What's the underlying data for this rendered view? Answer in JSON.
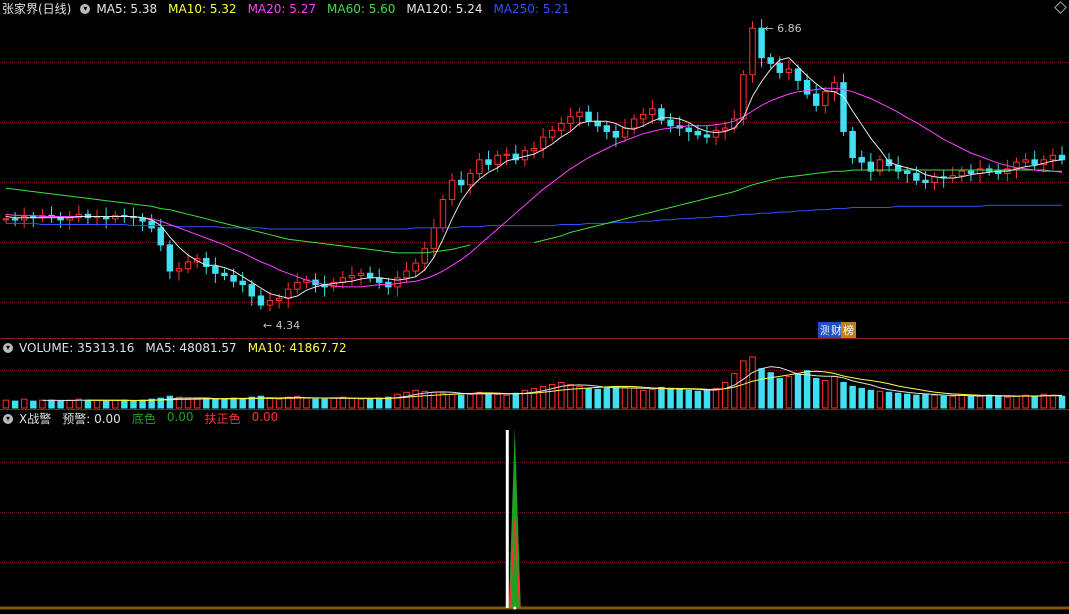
{
  "main_pane": {
    "title": "张家界(日线)",
    "ma_labels": [
      {
        "text": "MA5: 5.38",
        "color": "#e6e6e6"
      },
      {
        "text": "MA10: 5.32",
        "color": "#ffff40"
      },
      {
        "text": "MA20: 5.27",
        "color": "#ff40ff"
      },
      {
        "text": "MA60: 5.60",
        "color": "#40e040"
      },
      {
        "text": "MA120: 5.24",
        "color": "#e6e6e6"
      },
      {
        "text": "MA250: 5.21",
        "color": "#3050ff"
      }
    ],
    "high_label": "6.86",
    "low_label": "4.34",
    "badge_1": "测",
    "badge_2": "财",
    "badge_3": "榜"
  },
  "volume_pane": {
    "labels": [
      {
        "text": "VOLUME: 35313.16",
        "color": "#e0e0e0"
      },
      {
        "text": "MA5: 48081.57",
        "color": "#e0e0e0"
      },
      {
        "text": "MA10: 41867.72",
        "color": "#ffff40"
      }
    ]
  },
  "indicator_pane": {
    "labels": [
      {
        "text": "X战警",
        "color": "#e0e0e0"
      },
      {
        "text": "预警: 0.00",
        "color": "#e0e0e0"
      },
      {
        "text": "底色",
        "color": "#20a020"
      },
      {
        "text": "0.00",
        "color": "#20a020"
      },
      {
        "text": "扶正色",
        "color": "#ff3030"
      },
      {
        "text": "0.00",
        "color": "#ff3030"
      }
    ]
  },
  "chart_data": {
    "type": "candlestick",
    "price_range": [
      4.2,
      6.95
    ],
    "high": 6.86,
    "low": 4.34,
    "up_color": "#ff3030",
    "down_color": "#40e0f0",
    "closes": [
      5.18,
      5.17,
      5.2,
      5.19,
      5.21,
      5.2,
      5.17,
      5.19,
      5.22,
      5.19,
      5.2,
      5.18,
      5.21,
      5.2,
      5.19,
      5.16,
      5.1,
      4.95,
      4.72,
      4.74,
      4.8,
      4.83,
      4.76,
      4.7,
      4.68,
      4.63,
      4.6,
      4.5,
      4.42,
      4.46,
      4.48,
      4.56,
      4.62,
      4.64,
      4.6,
      4.58,
      4.62,
      4.66,
      4.68,
      4.7,
      4.66,
      4.62,
      4.58,
      4.66,
      4.72,
      4.79,
      4.92,
      5.1,
      5.35,
      5.52,
      5.48,
      5.58,
      5.7,
      5.66,
      5.74,
      5.75,
      5.7,
      5.78,
      5.8,
      5.9,
      5.96,
      6.02,
      6.08,
      6.12,
      6.04,
      6.0,
      5.95,
      5.9,
      5.98,
      6.06,
      6.1,
      6.15,
      6.05,
      6.0,
      5.98,
      5.95,
      5.92,
      5.9,
      5.96,
      5.98,
      6.06,
      6.45,
      6.86,
      6.6,
      6.55,
      6.47,
      6.5,
      6.4,
      6.28,
      6.18,
      6.3,
      6.38,
      5.95,
      5.72,
      5.68,
      5.6,
      5.7,
      5.65,
      5.6,
      5.58,
      5.52,
      5.5,
      5.55,
      5.54,
      5.56,
      5.6,
      5.58,
      5.62,
      5.6,
      5.58,
      5.62,
      5.68,
      5.7,
      5.66,
      5.7,
      5.74,
      5.7
    ],
    "volumes": [
      8,
      7,
      9,
      7,
      8,
      8,
      7,
      8,
      9,
      8,
      8,
      7,
      8,
      8,
      7,
      8,
      9,
      10,
      12,
      11,
      9,
      9,
      10,
      9,
      9,
      10,
      9,
      11,
      12,
      10,
      9,
      11,
      12,
      10,
      9,
      9,
      10,
      11,
      10,
      9,
      9,
      10,
      11,
      14,
      16,
      18,
      17,
      16,
      15,
      14,
      13,
      14,
      16,
      15,
      14,
      13,
      15,
      18,
      20,
      22,
      24,
      26,
      24,
      22,
      20,
      19,
      20,
      22,
      21,
      20,
      18,
      19,
      21,
      20,
      19,
      18,
      17,
      18,
      20,
      26,
      35,
      48,
      52,
      40,
      36,
      30,
      32,
      34,
      38,
      30,
      28,
      32,
      26,
      22,
      20,
      18,
      17,
      16,
      15,
      14,
      13,
      14,
      13,
      12,
      12,
      13,
      12,
      12,
      13,
      12,
      11,
      12,
      13,
      12,
      14,
      13,
      12
    ],
    "ma5": [
      5.2,
      5.19,
      5.19,
      5.19,
      5.19,
      5.19,
      5.19,
      5.19,
      5.2,
      5.2,
      5.2,
      5.2,
      5.2,
      5.2,
      5.2,
      5.19,
      5.17,
      5.12,
      5.02,
      4.93,
      4.86,
      4.81,
      4.77,
      4.77,
      4.75,
      4.72,
      4.67,
      4.62,
      4.57,
      4.52,
      4.5,
      4.48,
      4.5,
      4.55,
      4.58,
      4.6,
      4.61,
      4.62,
      4.63,
      4.65,
      4.66,
      4.66,
      4.65,
      4.64,
      4.65,
      4.67,
      4.73,
      4.84,
      5.0,
      5.18,
      5.34,
      5.45,
      5.53,
      5.59,
      5.63,
      5.69,
      5.71,
      5.73,
      5.75,
      5.79,
      5.84,
      5.9,
      5.95,
      6.02,
      6.04,
      6.04,
      6.04,
      6.02,
      5.98,
      5.97,
      6.0,
      6.04,
      6.07,
      6.07,
      6.06,
      6.03,
      5.98,
      5.95,
      5.94,
      5.95,
      5.98,
      6.07,
      6.26,
      6.39,
      6.5,
      6.58,
      6.6,
      6.52,
      6.44,
      6.37,
      6.31,
      6.3,
      6.26,
      6.13,
      6.01,
      5.89,
      5.79,
      5.68,
      5.65,
      5.63,
      5.61,
      5.57,
      5.55,
      5.54,
      5.54,
      5.55,
      5.57,
      5.58,
      5.59,
      5.6,
      5.6,
      5.62,
      5.64,
      5.65,
      5.67,
      5.69,
      5.7
    ],
    "ma20": [
      5.22,
      5.21,
      5.21,
      5.21,
      5.2,
      5.2,
      5.2,
      5.2,
      5.2,
      5.2,
      5.2,
      5.2,
      5.2,
      5.2,
      5.2,
      5.19,
      5.18,
      5.16,
      5.13,
      5.1,
      5.07,
      5.04,
      5.01,
      4.98,
      4.95,
      4.91,
      4.88,
      4.84,
      4.8,
      4.77,
      4.73,
      4.7,
      4.67,
      4.64,
      4.62,
      4.6,
      4.59,
      4.58,
      4.58,
      4.58,
      4.59,
      4.6,
      4.6,
      4.61,
      4.62,
      4.63,
      4.65,
      4.68,
      4.72,
      4.77,
      4.82,
      4.88,
      4.95,
      5.02,
      5.09,
      5.16,
      5.23,
      5.3,
      5.37,
      5.44,
      5.5,
      5.56,
      5.62,
      5.67,
      5.72,
      5.76,
      5.8,
      5.84,
      5.87,
      5.9,
      5.93,
      5.95,
      5.97,
      5.98,
      5.99,
      6.0,
      6.0,
      6.0,
      6.01,
      6.02,
      6.04,
      6.08,
      6.13,
      6.18,
      6.22,
      6.25,
      6.28,
      6.3,
      6.31,
      6.32,
      6.33,
      6.33,
      6.32,
      6.3,
      6.27,
      6.24,
      6.2,
      6.16,
      6.12,
      6.07,
      6.03,
      5.98,
      5.93,
      5.88,
      5.84,
      5.8,
      5.76,
      5.73,
      5.7,
      5.67,
      5.65,
      5.63,
      5.62,
      5.61,
      5.6,
      5.6,
      5.59
    ],
    "ma60": [
      5.45,
      5.44,
      5.43,
      5.42,
      5.41,
      5.4,
      5.39,
      5.38,
      5.37,
      5.36,
      5.35,
      5.34,
      5.33,
      5.32,
      5.31,
      5.3,
      5.29,
      5.27,
      5.26,
      5.24,
      5.22,
      5.2,
      5.18,
      5.16,
      5.14,
      5.12,
      5.1,
      5.08,
      5.06,
      5.04,
      5.02,
      5.0,
      4.99,
      4.98,
      4.97,
      4.96,
      4.95,
      4.94,
      4.93,
      4.92,
      4.91,
      4.9,
      4.89,
      4.88,
      4.88,
      4.88,
      4.88,
      4.89,
      4.9,
      4.91,
      4.93,
      4.95,
      null,
      null,
      null,
      null,
      null,
      null,
      4.97,
      4.99,
      5.01,
      5.03,
      5.06,
      5.08,
      5.1,
      5.12,
      5.14,
      5.16,
      5.18,
      5.2,
      5.22,
      5.24,
      5.26,
      5.28,
      5.3,
      5.32,
      5.34,
      5.36,
      5.38,
      5.4,
      5.42,
      5.45,
      5.48,
      5.5,
      5.52,
      5.54,
      5.55,
      5.56,
      5.57,
      5.58,
      5.59,
      5.6,
      5.6,
      5.61,
      5.61,
      5.61,
      5.61,
      5.61,
      5.61,
      5.61,
      5.61,
      5.61,
      5.61,
      5.61,
      5.61,
      5.61,
      5.61,
      5.61,
      5.61,
      5.61,
      5.61,
      5.61,
      5.61,
      5.61,
      5.61,
      5.6,
      5.6
    ],
    "ma250": [
      5.14,
      5.14,
      5.14,
      5.14,
      5.13,
      5.13,
      5.13,
      5.13,
      5.13,
      5.13,
      5.13,
      5.13,
      5.13,
      5.13,
      5.12,
      5.12,
      5.12,
      5.12,
      5.12,
      5.11,
      5.11,
      5.11,
      5.11,
      5.11,
      5.1,
      5.1,
      5.1,
      5.1,
      5.1,
      5.09,
      5.09,
      5.09,
      5.09,
      5.09,
      5.09,
      5.09,
      5.09,
      5.09,
      5.09,
      5.09,
      5.09,
      5.09,
      5.09,
      5.09,
      5.09,
      5.1,
      5.1,
      5.1,
      5.1,
      5.1,
      5.11,
      5.11,
      5.11,
      5.12,
      5.12,
      5.12,
      5.12,
      5.12,
      5.12,
      5.12,
      5.12,
      5.13,
      5.13,
      5.13,
      5.14,
      5.14,
      5.14,
      5.15,
      5.15,
      5.15,
      5.16,
      5.16,
      5.17,
      5.17,
      5.18,
      5.18,
      5.19,
      5.19,
      5.2,
      5.2,
      5.21,
      5.22,
      5.22,
      5.23,
      5.23,
      5.24,
      5.24,
      5.25,
      5.25,
      5.26,
      5.26,
      5.27,
      5.27,
      5.28,
      5.28,
      5.28,
      5.28,
      5.28,
      5.29,
      5.29,
      5.29,
      5.29,
      5.29,
      5.29,
      5.29,
      5.29,
      5.29,
      5.29,
      5.3,
      5.3,
      5.3,
      5.3,
      5.3,
      5.3,
      5.3,
      5.3,
      5.3
    ],
    "signal_index": 56
  }
}
